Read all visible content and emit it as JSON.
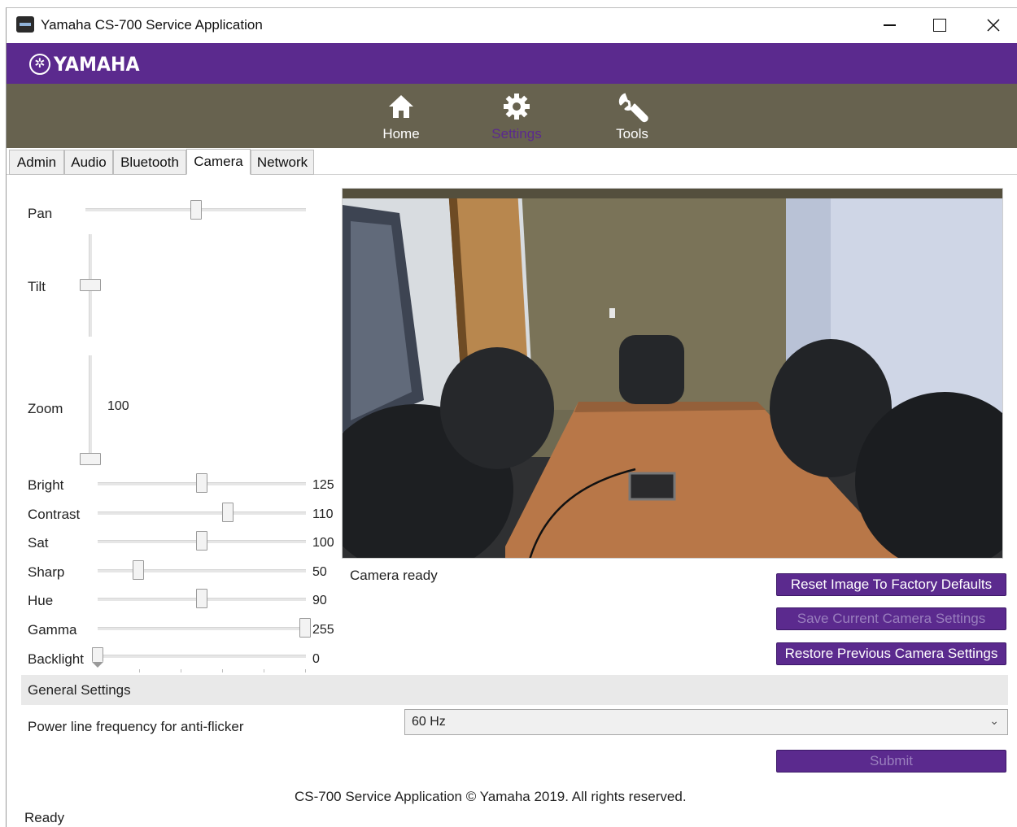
{
  "window": {
    "title": "Yamaha CS-700 Service Application"
  },
  "brand": {
    "name": "YAMAHA"
  },
  "nav": [
    {
      "label": "Home",
      "icon": "home-icon"
    },
    {
      "label": "Settings",
      "icon": "gear-icon",
      "active": true
    },
    {
      "label": "Tools",
      "icon": "wrench-icon"
    }
  ],
  "tabs": [
    "Admin",
    "Audio",
    "Bluetooth",
    "Camera",
    "Network"
  ],
  "active_tab": "Camera",
  "controls": {
    "pan": {
      "label": "Pan",
      "level": 0.5
    },
    "tilt": {
      "label": "Tilt",
      "level": 0.5
    },
    "zoom": {
      "label": "Zoom",
      "value": "100",
      "level": 0
    },
    "sliders": [
      {
        "label": "Bright",
        "value": "125"
      },
      {
        "label": "Contrast",
        "value": "110"
      },
      {
        "label": "Sat",
        "value": "100"
      },
      {
        "label": "Sharp",
        "value": "50"
      },
      {
        "label": "Hue",
        "value": "90"
      },
      {
        "label": "Gamma",
        "value": "255"
      },
      {
        "label": "Backlight",
        "value": "0"
      }
    ]
  },
  "camera": {
    "status": "Camera ready"
  },
  "buttons": {
    "reset": "Reset Image To Factory Defaults",
    "save": "Save Current Camera Settings",
    "restore": "Restore Previous Camera Settings",
    "submit": "Submit"
  },
  "general": {
    "header": "General Settings",
    "power_label": "Power line frequency for anti-flicker",
    "power_value": "60 Hz"
  },
  "footer": "CS-700 Service Application © Yamaha 2019. All rights reserved.",
  "status": "Ready",
  "colors": {
    "brand": "#5b2a8e",
    "nav": "#67624f"
  }
}
